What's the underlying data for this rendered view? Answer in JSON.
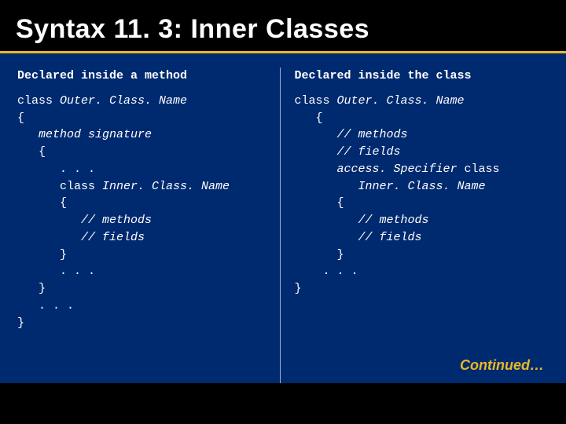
{
  "title": "Syntax 11. 3: Inner Classes",
  "left": {
    "heading": "Declared inside a method",
    "l1a": "class ",
    "l1b": "Outer. Class. Name",
    "l2": "{",
    "l3": "   method signature",
    "l4": "   {",
    "l5": "      . . .",
    "l6a": "      class ",
    "l6b": "Inner. Class. Name",
    "l7": "      {",
    "l8": "         // methods",
    "l9": "         // fields",
    "l10": "      }",
    "l11": "      . . .",
    "l12": "   }",
    "l13": "   . . .",
    "l14": "}"
  },
  "right": {
    "heading": "Declared inside the class",
    "l1a": "class ",
    "l1b": "Outer. Class. Name",
    "l2": "   {",
    "l3": "      // methods",
    "l4": "      // fields",
    "l5a": "      access. Specifier",
    "l5b": " class",
    "l6": "         Inner. Class. Name",
    "l7": "      {",
    "l8": "         // methods",
    "l9": "         // fields",
    "l10": "      }",
    "l11": "    . . .",
    "l12": "}"
  },
  "continued": "Continued…"
}
